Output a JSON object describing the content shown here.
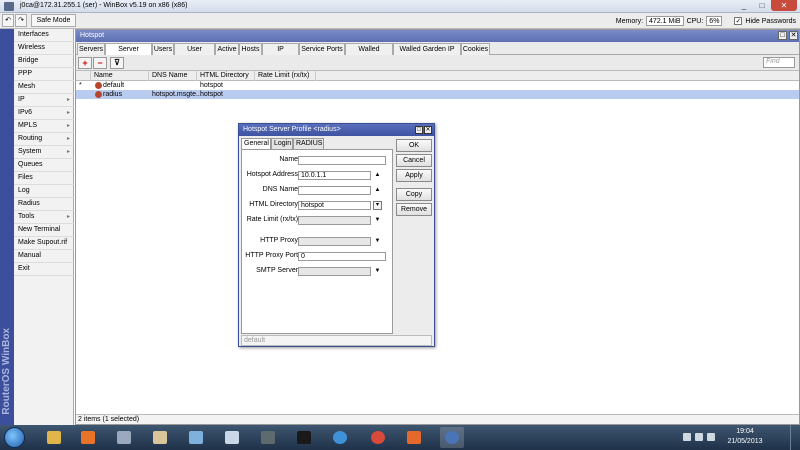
{
  "window": {
    "title": "j0ca@172.31.255.1 (ser) - WinBox v5.19 on x86 (x86)",
    "min": "_",
    "max": "□",
    "close": "✕"
  },
  "toolbar": {
    "undo": "↶",
    "redo": "↷",
    "safe_mode": "Safe Mode",
    "memory_label": "Memory:",
    "memory_value": "472.1 MiB",
    "cpu_label": "CPU:",
    "cpu_value": "6%",
    "hide_passwords_label": "Hide Passwords",
    "hide_passwords_checked": "✓"
  },
  "brand": "RouterOS WinBox",
  "sidebar": {
    "items": [
      {
        "label": "Interfaces",
        "arrow": ""
      },
      {
        "label": "Wireless",
        "arrow": ""
      },
      {
        "label": "Bridge",
        "arrow": ""
      },
      {
        "label": "PPP",
        "arrow": ""
      },
      {
        "label": "Mesh",
        "arrow": ""
      },
      {
        "label": "IP",
        "arrow": "▸"
      },
      {
        "label": "IPv6",
        "arrow": "▸"
      },
      {
        "label": "MPLS",
        "arrow": "▸"
      },
      {
        "label": "Routing",
        "arrow": "▸"
      },
      {
        "label": "System",
        "arrow": "▸"
      },
      {
        "label": "Queues",
        "arrow": ""
      },
      {
        "label": "Files",
        "arrow": ""
      },
      {
        "label": "Log",
        "arrow": ""
      },
      {
        "label": "Radius",
        "arrow": ""
      },
      {
        "label": "Tools",
        "arrow": "▸"
      },
      {
        "label": "New Terminal",
        "arrow": ""
      },
      {
        "label": "Make Supout.rif",
        "arrow": ""
      },
      {
        "label": "Manual",
        "arrow": ""
      },
      {
        "label": "Exit",
        "arrow": ""
      }
    ]
  },
  "hotspot": {
    "title": "Hotspot",
    "restore": "□",
    "close": "✕",
    "tabs": [
      "Servers",
      "Server Profiles",
      "Users",
      "User Profiles",
      "Active",
      "Hosts",
      "IP Bindings",
      "Service Ports",
      "Walled Garden",
      "Walled Garden IP List",
      "Cookies"
    ],
    "active_tab": "Server Profiles",
    "add": "+",
    "remove": "−",
    "filter": "⊽",
    "find_placeholder": "Find",
    "columns": [
      "Name",
      "DNS Name",
      "HTML Directory",
      "Rate Limit (rx/tx)"
    ],
    "rows": [
      {
        "flag": "*",
        "name": "default",
        "dns": "",
        "html_dir": "hotspot",
        "rate": ""
      },
      {
        "flag": "",
        "name": "radius",
        "dns": "hotspot.msgte...",
        "html_dir": "hotspot",
        "rate": ""
      }
    ],
    "status": "2 items (1 selected)"
  },
  "dialog": {
    "title": "Hotspot Server Profile <radius>",
    "restore": "□",
    "close": "✕",
    "tabs": [
      "General",
      "Login",
      "RADIUS"
    ],
    "active_tab": "General",
    "fields": {
      "name": {
        "label": "Name:",
        "value": ""
      },
      "hotspot_address": {
        "label": "Hotspot Address:",
        "value": "10.0.1.1"
      },
      "dns_name": {
        "label": "DNS Name:",
        "value": ""
      },
      "html_directory": {
        "label": "HTML Directory:",
        "value": "hotspot"
      },
      "rate_limit": {
        "label": "Rate Limit (rx/tx):",
        "value": ""
      },
      "http_proxy": {
        "label": "HTTP Proxy:",
        "value": ""
      },
      "http_proxy_port": {
        "label": "HTTP Proxy Port:",
        "value": "0"
      },
      "smtp_server": {
        "label": "SMTP Server:",
        "value": ""
      }
    },
    "buttons": {
      "ok": "OK",
      "cancel": "Cancel",
      "apply": "Apply",
      "copy": "Copy",
      "remove": "Remove"
    },
    "status": "default",
    "up_arrow": "▲",
    "down_arrow": "▼",
    "select_arrow": "▾"
  },
  "taskbar": {
    "time": "19:04",
    "date": "21/05/2013"
  }
}
